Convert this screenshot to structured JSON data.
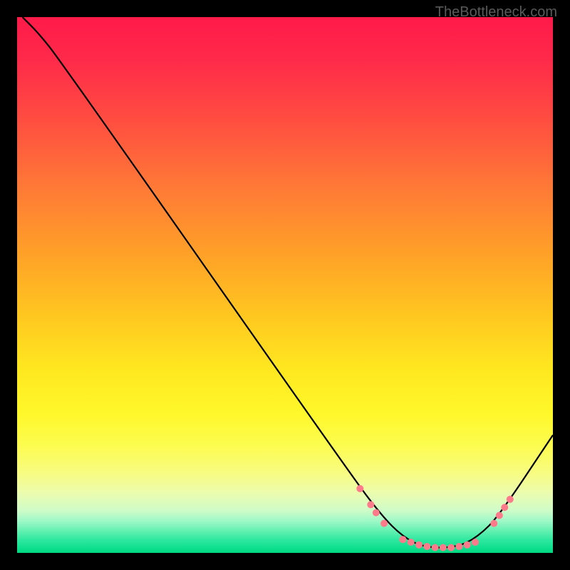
{
  "attribution": "TheBottleneck.com",
  "chart_data": {
    "type": "line",
    "title": "",
    "xlabel": "",
    "ylabel": "",
    "xlim": [
      0,
      100
    ],
    "ylim": [
      0,
      100
    ],
    "curve": [
      {
        "x": 1,
        "y": 100
      },
      {
        "x": 4,
        "y": 97
      },
      {
        "x": 8,
        "y": 92
      },
      {
        "x": 62,
        "y": 15
      },
      {
        "x": 68,
        "y": 7
      },
      {
        "x": 72,
        "y": 3
      },
      {
        "x": 76,
        "y": 1
      },
      {
        "x": 82,
        "y": 1
      },
      {
        "x": 86,
        "y": 3
      },
      {
        "x": 90,
        "y": 7
      },
      {
        "x": 100,
        "y": 22
      }
    ],
    "markers": [
      {
        "x": 64,
        "y": 12
      },
      {
        "x": 66,
        "y": 9
      },
      {
        "x": 67,
        "y": 7.5
      },
      {
        "x": 68.5,
        "y": 5.5
      },
      {
        "x": 72,
        "y": 2.5
      },
      {
        "x": 73.5,
        "y": 2
      },
      {
        "x": 75,
        "y": 1.5
      },
      {
        "x": 76.5,
        "y": 1.2
      },
      {
        "x": 78,
        "y": 1
      },
      {
        "x": 79.5,
        "y": 1
      },
      {
        "x": 81,
        "y": 1
      },
      {
        "x": 82.5,
        "y": 1.2
      },
      {
        "x": 84,
        "y": 1.5
      },
      {
        "x": 85.5,
        "y": 2
      },
      {
        "x": 89,
        "y": 5.5
      },
      {
        "x": 90,
        "y": 7
      },
      {
        "x": 91,
        "y": 8.5
      },
      {
        "x": 92,
        "y": 10
      }
    ],
    "marker_color": "#ff7a8a",
    "line_color": "#000000"
  }
}
